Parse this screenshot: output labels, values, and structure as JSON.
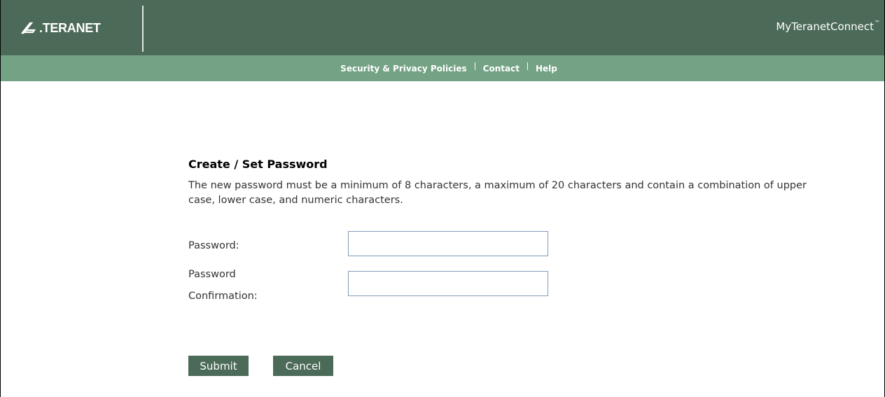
{
  "header": {
    "logo_text": ".TERANET",
    "app_title": "MyTeranetConnect",
    "app_title_mark": "™",
    "background_color": "#4c6a58"
  },
  "nav": {
    "background_color": "#74a285",
    "links": [
      {
        "label": "Security & Privacy Policies"
      },
      {
        "label": "Contact"
      },
      {
        "label": "Help"
      }
    ]
  },
  "form": {
    "title": "Create / Set Password",
    "description": "The new password must be a minimum of 8 characters, a maximum of 20 characters and contain a combination of upper case, lower case, and numeric characters.",
    "password_label": "Password:",
    "password_value": "",
    "confirmation_label_line1": "Password",
    "confirmation_label_line2": "Confirmation:",
    "confirmation_value": "",
    "submit_label": "Submit",
    "cancel_label": "Cancel"
  },
  "icons": {
    "logo_mark": "teranet-logo-mark-icon"
  }
}
